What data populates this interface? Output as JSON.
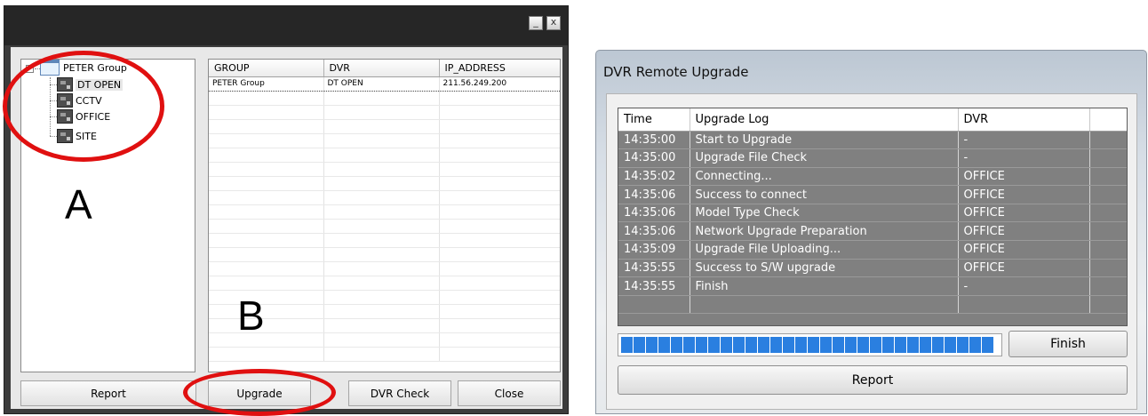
{
  "left_dialog": {
    "window_controls": {
      "minimize": "_",
      "close": "x"
    },
    "tree": {
      "root": {
        "label": "PETER Group",
        "toggle": "-"
      },
      "children": [
        {
          "label": "DT OPEN",
          "selected": true
        },
        {
          "label": "CCTV",
          "selected": false
        },
        {
          "label": "OFFICE",
          "selected": false
        },
        {
          "label": "SITE",
          "selected": false
        }
      ]
    },
    "grid": {
      "columns": [
        "GROUP",
        "DVR",
        "IP_ADDRESS"
      ],
      "rows": [
        [
          "PETER Group",
          "DT OPEN",
          "211.56.249.200"
        ]
      ]
    },
    "buttons": {
      "report": "Report",
      "upgrade": "Upgrade",
      "dvr_check": "DVR Check",
      "close": "Close"
    },
    "annotations": {
      "a": "A",
      "b": "B",
      "color": "#e01010"
    }
  },
  "right_dialog": {
    "title": "DVR Remote Upgrade",
    "log": {
      "columns": [
        "Time",
        "Upgrade Log",
        "DVR",
        ""
      ],
      "rows": [
        [
          "14:35:00",
          "Start to Upgrade",
          "-"
        ],
        [
          "14:35:00",
          "Upgrade File Check",
          "-"
        ],
        [
          "14:35:02",
          "Connecting...",
          "OFFICE"
        ],
        [
          "14:35:06",
          "Success to connect",
          "OFFICE"
        ],
        [
          "14:35:06",
          "Model Type Check",
          "OFFICE"
        ],
        [
          "14:35:06",
          "Network Upgrade Preparation",
          "OFFICE"
        ],
        [
          "14:35:09",
          "Upgrade File Uploading...",
          "OFFICE"
        ],
        [
          "14:35:55",
          "Success to S/W upgrade",
          "OFFICE"
        ],
        [
          "14:35:55",
          "Finish",
          "-"
        ],
        [
          "",
          "",
          ""
        ]
      ]
    },
    "progress": {
      "fraction": 1.0,
      "color": "#2a7fe0"
    },
    "buttons": {
      "finish": "Finish",
      "report": "Report"
    }
  }
}
